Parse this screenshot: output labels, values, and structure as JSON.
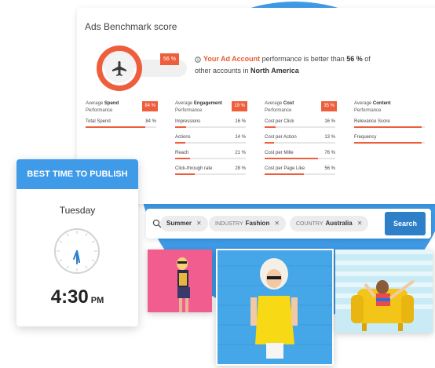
{
  "benchmark": {
    "title": "Ads Benchmark score",
    "gauge_percent": "56 %",
    "summary": {
      "link": "Your Ad Account",
      "text1": " performance is better than ",
      "pct": "56 %",
      "text2": " of other accounts in ",
      "region": "North America"
    },
    "columns": [
      {
        "head_prefix": "Average ",
        "head_bold": "Spend",
        "head_suffix": "Performance",
        "badge": "84 %",
        "rows": [
          {
            "label": "Total Spend",
            "value": "84 %",
            "fill": 0.84
          }
        ]
      },
      {
        "head_prefix": "Average ",
        "head_bold": "Engagement",
        "head_suffix": "Performance",
        "badge": "19 %",
        "rows": [
          {
            "label": "Impressions",
            "value": "16 %",
            "fill": 0.16
          },
          {
            "label": "Actions",
            "value": "14 %",
            "fill": 0.14
          },
          {
            "label": "Reach",
            "value": "21 %",
            "fill": 0.21
          },
          {
            "label": "Click-through rate",
            "value": "28 %",
            "fill": 0.28
          }
        ]
      },
      {
        "head_prefix": "Average ",
        "head_bold": "Cost",
        "head_suffix": "Performance",
        "badge": "35 %",
        "rows": [
          {
            "label": "Cost per Click",
            "value": "16 %",
            "fill": 0.16
          },
          {
            "label": "Cost per Action",
            "value": "13 %",
            "fill": 0.13
          },
          {
            "label": "Cost per Mille",
            "value": "76 %",
            "fill": 0.76
          },
          {
            "label": "Cost per Page Like",
            "value": "56 %",
            "fill": 0.56
          }
        ]
      },
      {
        "head_prefix": "Average ",
        "head_bold": "Content",
        "head_suffix": "Performance",
        "badge": "",
        "rows": [
          {
            "label": "Relevance Score",
            "value": "",
            "fill": 0.95
          },
          {
            "label": "Frequency",
            "value": "",
            "fill": 0.95
          }
        ]
      }
    ]
  },
  "publish": {
    "header": "BEST TIME TO PUBLISH",
    "day": "Tuesday",
    "time": "4:30",
    "ampm": "PM"
  },
  "search": {
    "chips": [
      {
        "key": "",
        "value": "Summer"
      },
      {
        "key": "INDUSTRY",
        "value": "Fashion"
      },
      {
        "key": "COUNTRY",
        "value": "Australia"
      }
    ],
    "button": "Search"
  },
  "colors": {
    "accent": "#ee5e3c",
    "blue": "#3f9be8",
    "button": "#2d7fc8"
  }
}
